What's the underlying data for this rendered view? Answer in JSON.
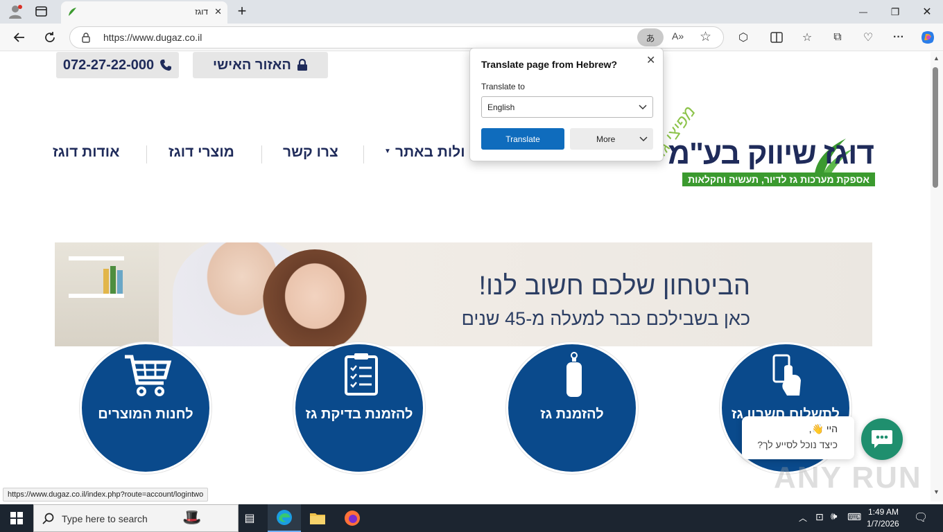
{
  "browser": {
    "tab_title": "דוגז",
    "url": "https://www.dugaz.co.il",
    "new_tab_symbol": "+",
    "minimize_symbol": "—",
    "restore_symbol": "❐",
    "close_symbol": "✕"
  },
  "site": {
    "phone": "072-27-22-000",
    "personal_area": "האזור האישי",
    "logo": {
      "name": "דוגז שיווק בע\"מ",
      "tagline": "אספקת מערכות גז לדיור, תעשיה וחקלאות",
      "arc_text": "מפיצי גז"
    },
    "nav": [
      "אודות דוגז",
      "מוצרי דוגז",
      "צרו קשר",
      "פעולות באתר"
    ],
    "nav_visible_partial": "ולות באתר",
    "banner": {
      "headline": "הביטחון שלכם חשוב לנו!",
      "subline": "כאן בשבילכם כבר למעלה מ-45 שנים"
    },
    "circles": [
      {
        "label": "לחנות המוצרים",
        "icon": "shopping-cart-icon"
      },
      {
        "label": "להזמנת בדיקת גז",
        "icon": "clipboard-checklist-icon"
      },
      {
        "label": "להזמנת גז",
        "icon": "gas-cylinder-icon"
      },
      {
        "label": "לתשלום חשבון גז",
        "icon": "hand-card-icon"
      }
    ],
    "chat": {
      "greeting": "היי 👋,",
      "question": "כיצד נוכל לסייע לך?"
    }
  },
  "translate_popup": {
    "title": "Translate page from Hebrew?",
    "translate_to_label": "Translate to",
    "selected_language": "English",
    "translate_button": "Translate",
    "more_button": "More"
  },
  "status_bar": {
    "url": "https://www.dugaz.co.il/index.php?route=account/logintwo"
  },
  "taskbar": {
    "search_placeholder": "Type here to search",
    "time": "1:49 AM",
    "date": "1/7/2026"
  },
  "watermark": "ANY RUN",
  "colors": {
    "navy": "#1f2b5a",
    "circle_blue": "#0a4a8c",
    "logo_green": "#3b9a2f",
    "translate_blue": "#0f6cbd",
    "chat_green": "#1f8f6e"
  }
}
